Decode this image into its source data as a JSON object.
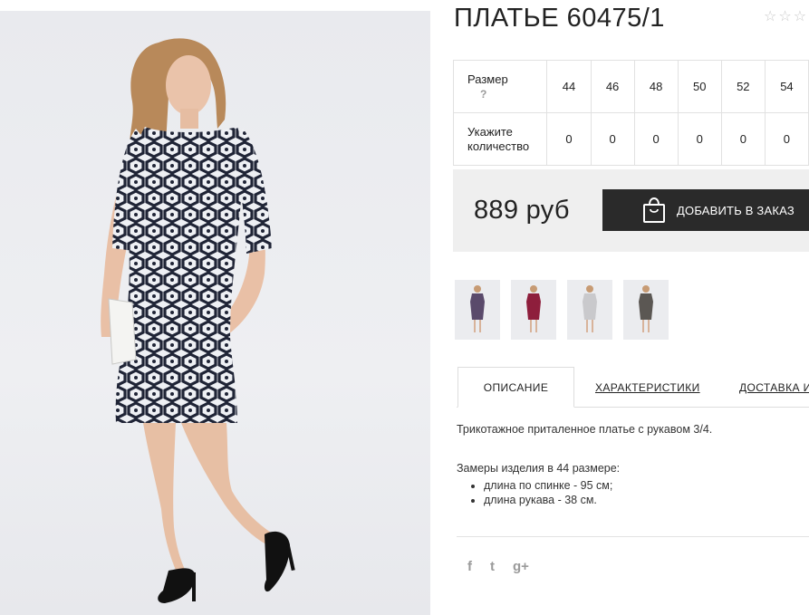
{
  "product": {
    "title": "ПЛАТЬЕ 60475/1",
    "rating_stars": [
      "☆",
      "☆",
      "☆"
    ],
    "photo_alt_icon": "product-photo-dress"
  },
  "size_table": {
    "size_label": "Размер",
    "help_mark": "?",
    "qty_label": "Укажите количество",
    "sizes": [
      "44",
      "46",
      "48",
      "50",
      "52",
      "54"
    ],
    "quantities": [
      "0",
      "0",
      "0",
      "0",
      "0",
      "0"
    ]
  },
  "purchase": {
    "price": "889 руб",
    "add_button_label": "ДОБАВИТЬ В ЗАКАЗ",
    "add_button_icon": "shopping-bag-icon"
  },
  "thumbnails": [
    {
      "name": "thumb-dress-pattern",
      "dress_color": "#5a4a6b"
    },
    {
      "name": "thumb-dress-burgundy",
      "dress_color": "#8e1e3c"
    },
    {
      "name": "thumb-dress-light-grey",
      "dress_color": "#c9c9cc"
    },
    {
      "name": "thumb-dress-dark-grey",
      "dress_color": "#5b5753"
    }
  ],
  "tabs": {
    "description": "ОПИСАНИЕ",
    "characteristics": "ХАРАКТЕРИСТИКИ",
    "delivery": "ДОСТАВКА И"
  },
  "description": {
    "intro": "Трикотажное приталенное платье с рукавом 3/4.",
    "measure_title": "Замеры изделия в 44 размере:",
    "items": [
      "длина по спинке - 95 см;",
      "длина рукава - 38 см."
    ]
  },
  "social": {
    "facebook": "f",
    "twitter": "t",
    "googleplus": "g+"
  },
  "colors": {
    "button_bg": "#2a2a2a",
    "price_bg": "#efefef",
    "border": "#e1e1e1"
  }
}
